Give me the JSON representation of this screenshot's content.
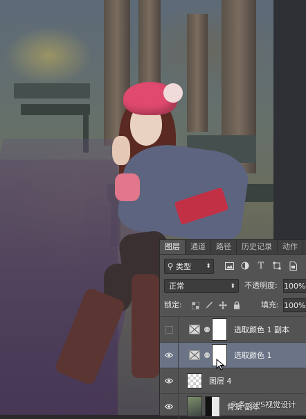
{
  "layers_panel": {
    "tabs": [
      {
        "label": "图层",
        "active": true
      },
      {
        "label": "通道",
        "active": false
      },
      {
        "label": "路径",
        "active": false
      },
      {
        "label": "历史记录",
        "active": false
      },
      {
        "label": "动作",
        "active": false
      }
    ],
    "filter": {
      "kind_label": "类型",
      "icons": [
        "image-filter-icon",
        "adjustment-filter-icon",
        "type-filter-icon",
        "shape-filter-icon",
        "smart-object-filter-icon"
      ]
    },
    "blend_mode": "正常",
    "opacity_label": "不透明度:",
    "opacity_value": "100%",
    "lock_label": "锁定:",
    "lock_icons": [
      "lock-transparent-icon",
      "lock-paint-icon",
      "lock-position-icon",
      "lock-all-icon"
    ],
    "fill_label": "填充:",
    "fill_value": "100%",
    "layers": [
      {
        "name": "选取颜色 1 副本",
        "visible": false,
        "selected": false,
        "type": "adjustment"
      },
      {
        "name": "选取颜色 1",
        "visible": true,
        "selected": true,
        "type": "adjustment"
      },
      {
        "name": "图层 4",
        "visible": true,
        "selected": false,
        "type": "pixel"
      },
      {
        "name": "背景 副本",
        "visible": true,
        "selected": false,
        "type": "photo"
      }
    ]
  },
  "watermark": {
    "text": "头条 @PS视觉设计"
  },
  "colors": {
    "panel_bg": "#535353",
    "tab_bar_bg": "#3f3f3f",
    "selected_layer": "#6b7486",
    "hat": "#e04a6e",
    "belt": "#c23046"
  }
}
